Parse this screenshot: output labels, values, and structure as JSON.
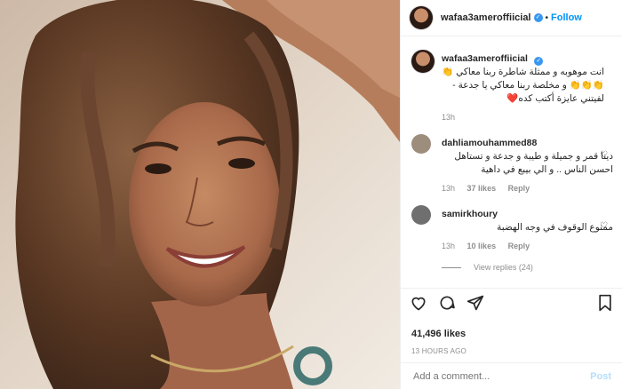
{
  "header": {
    "username": "wafaa3ameroffiicial",
    "separator": "•",
    "follow_label": "Follow"
  },
  "caption": {
    "username": "wafaa3ameroffiicial",
    "text": "انت موهوبه و ممثلة شاطرة ربنا معاكي 👏👏👏👏 و مخلصة ربنا معاكي يا جدعة - لفيتني عايزة أكتب كده❤️",
    "time": "13h"
  },
  "comments": [
    {
      "username": "dahliamouhammed88",
      "text": "دينا قمر و جميلة و طيبة و جدعة و تستاهل احسن الناس .. و الي بيبع في داهية",
      "time": "13h",
      "likes": "37 likes",
      "reply_label": "Reply"
    },
    {
      "username": "samirkhoury",
      "text": "ممنوع الوقوف في وجه الهضبة",
      "time": "13h",
      "likes": "10 likes",
      "reply_label": "Reply"
    }
  ],
  "view_replies": "View replies (24)",
  "likes": "41,496 likes",
  "timestamp": "13 HOURS AGO",
  "add_comment": {
    "placeholder": "Add a comment...",
    "post_label": "Post"
  },
  "colors": {
    "accent": "#0095f6",
    "verified": "#3897f0",
    "muted": "#8e8e8e"
  }
}
